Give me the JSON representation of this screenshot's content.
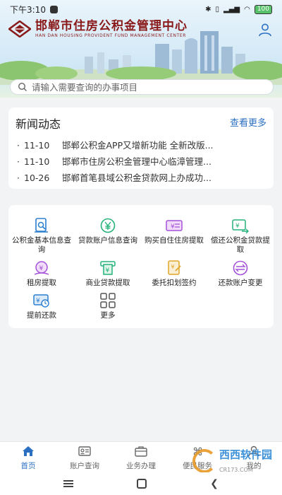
{
  "status_bar": {
    "time": "下午3:10"
  },
  "header": {
    "logo_cn": "邯郸市住房公积金管理中心",
    "logo_en": "HAN DAN HOUSING PROVIDENT FUND MANAGEMENT CENTER"
  },
  "search": {
    "placeholder": "请输入需要查询的办事项目"
  },
  "news": {
    "title": "新闻动态",
    "more": "查看更多",
    "items": [
      {
        "date": "11-10",
        "text": "邯郸公积金APP又增新功能 全新改版..."
      },
      {
        "date": "11-10",
        "text": "邯郸市住房公积金管理中心临漳管理..."
      },
      {
        "date": "10-26",
        "text": "邯郸首笔县域公积金贷款网上办成功..."
      }
    ]
  },
  "services": [
    {
      "label": "公积金基本信息查询",
      "icon": "document-search-icon",
      "color": "#2b7fd1"
    },
    {
      "label": "贷款账户信息查询",
      "icon": "yuan-coin-icon",
      "color": "#25b37a"
    },
    {
      "label": "购买自住住房提取",
      "icon": "money-card-icon",
      "color": "#a552d8"
    },
    {
      "label": "偿还公积金贷款提取",
      "icon": "yuan-transfer-icon",
      "color": "#25b37a"
    },
    {
      "label": "租房提取",
      "icon": "rent-coin-icon",
      "color": "#a552d8"
    },
    {
      "label": "商业贷款提取",
      "icon": "atm-yuan-icon",
      "color": "#25b37a"
    },
    {
      "label": "委托扣划签约",
      "icon": "sign-contract-icon",
      "color": "#e0a52a"
    },
    {
      "label": "还款账户变更",
      "icon": "exchange-icon",
      "color": "#a552d8"
    },
    {
      "label": "提前还款",
      "icon": "early-repay-icon",
      "color": "#2b7fd1"
    },
    {
      "label": "更多",
      "icon": "grid-more-icon",
      "color": "#555555"
    }
  ],
  "tabs": [
    {
      "label": "首页",
      "icon": "home-icon",
      "active": true
    },
    {
      "label": "账户查询",
      "icon": "id-card-icon",
      "active": false
    },
    {
      "label": "业务办理",
      "icon": "briefcase-icon",
      "active": false
    },
    {
      "label": "便民服务",
      "icon": "command-icon",
      "active": false
    },
    {
      "label": "我的",
      "icon": "person-icon",
      "active": false
    }
  ],
  "watermark": {
    "text": "西西软件园",
    "sub": "CR173.COM"
  },
  "colors": {
    "accent": "#2b6fc2",
    "brand": "#8a1a1a"
  }
}
